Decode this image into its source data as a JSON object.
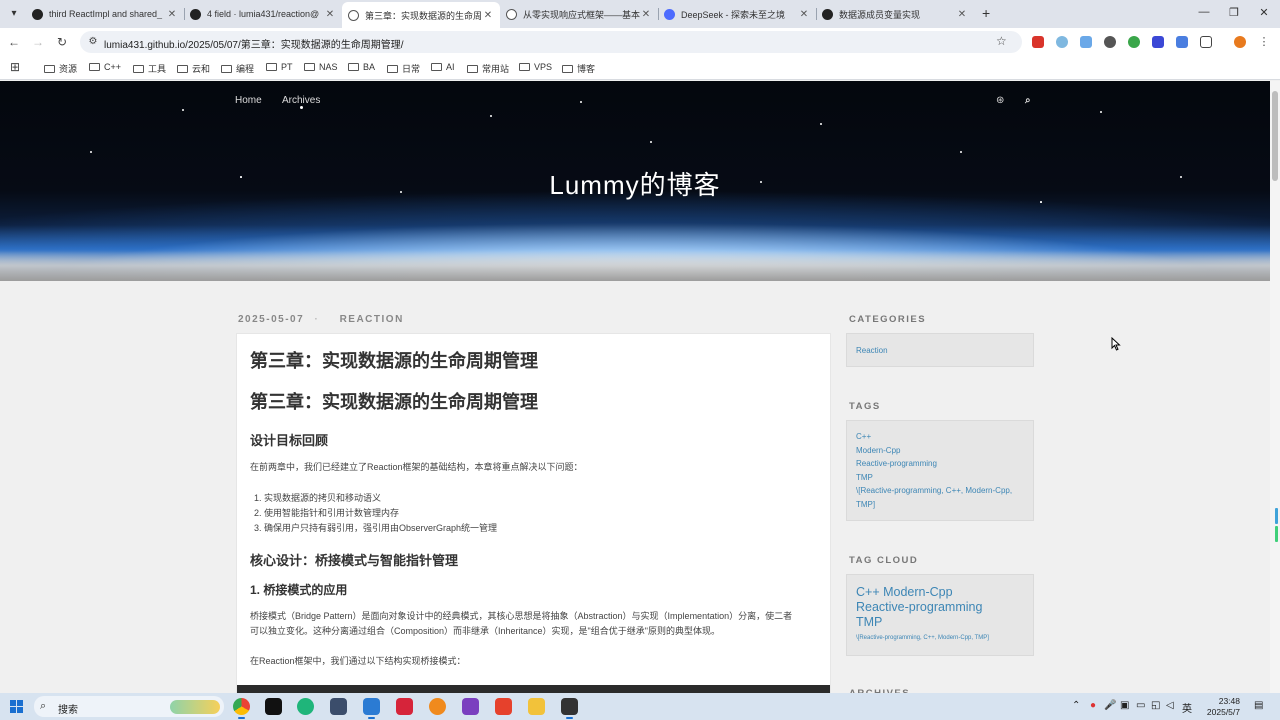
{
  "browser": {
    "tabs": [
      {
        "title": "third ReactImpl and shared_",
        "favicon_color": "#222222",
        "active": false
      },
      {
        "title": "4 field · lumia431/reaction@",
        "favicon_color": "#222222",
        "active": false
      },
      {
        "title": "第三章：实现数据源的生命周期",
        "favicon_color": "#555555",
        "active": true
      },
      {
        "title": "从零实现响应式框架——基本",
        "favicon_color": "#555555",
        "active": false
      },
      {
        "title": "DeepSeek - 探索未至之境",
        "favicon_color": "#4d6bfe",
        "active": false
      },
      {
        "title": "数据源成员变量实现",
        "favicon_color": "#222222",
        "active": false
      }
    ],
    "new_tab": "+",
    "window_controls": {
      "minimize": "—",
      "restore": "❐",
      "close": "✕"
    },
    "nav": {
      "back": "←",
      "forward": "→",
      "reload": "↻"
    },
    "url": "lumia431.github.io/2025/05/07/第三章：实现数据源的生命周期管理/",
    "bookmark_star": "☆",
    "bookmarks": [
      "资源",
      "C++",
      "工具",
      "云和",
      "编程",
      "PT",
      "NAS",
      "BA",
      "日常",
      "AI",
      "常用站",
      "VPS",
      "博客"
    ]
  },
  "site": {
    "nav": [
      "Home",
      "Archives"
    ],
    "title": "Lummy的博客",
    "rss": "⊛",
    "search": "⌕"
  },
  "post": {
    "date": "2025-05-07",
    "category": "REACTION",
    "title": "第三章：实现数据源的生命周期管理",
    "h1": "第三章：实现数据源的生命周期管理",
    "section1": "设计目标回顾",
    "intro": "在前两章中，我们已经建立了Reaction框架的基础结构，本章将重点解决以下问题：",
    "goals": [
      "1. 实现数据源的拷贝和移动语义",
      "2. 使用智能指针和引用计数管理内存",
      "3. 确保用户只持有弱引用，强引用由ObserverGraph统一管理"
    ],
    "section2": "核心设计：桥接模式与智能指针管理",
    "section3": "1. 桥接模式的应用",
    "para1_line1": "桥接模式（Bridge Pattern）是面向对象设计中的经典模式，其核心思想是将抽象（Abstraction）与实现（Implementation）分离，使二者",
    "para1_line2": "可以独立变化。这种分离通过组合（Composition）而非继承（Inheritance）实现，是\"组合优于继承\"原则的典型体现。",
    "para2": "在Reaction框架中，我们通过以下结构实现桥接模式："
  },
  "sidebar": {
    "categories_title": "CATEGORIES",
    "categories": [
      "Reaction"
    ],
    "tags_title": "TAGS",
    "tags": [
      "C++",
      "Modern-Cpp",
      "Reactive-programming",
      "TMP",
      "\\[Reactive-programming, C++, Modern-Cpp,",
      "TMP]"
    ],
    "cloud_title": "TAG CLOUD",
    "cloud_line1": "C++  Modern-Cpp",
    "cloud_line2": "Reactive-programming",
    "cloud_line3": "TMP",
    "cloud_small": "\\[Reactive-programming, C++, Modern-Cpp, TMP]",
    "archives_title": "ARCHIVES"
  },
  "taskbar": {
    "search_label": "搜索",
    "tray_ime": "英",
    "time": "23:48",
    "date": "2025/5/7"
  },
  "colors": {
    "link": "#3d86b5",
    "tab_strip": "#dfe3eb",
    "taskbar": "#d7e3f0"
  }
}
